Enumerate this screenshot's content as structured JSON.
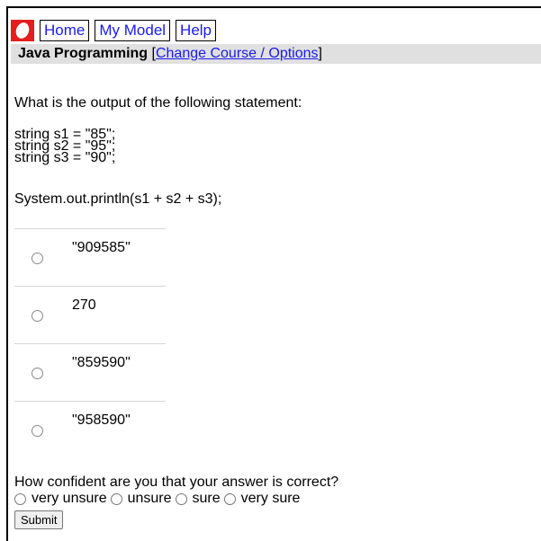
{
  "nav": {
    "home_label": "Home",
    "model_label": "My Model",
    "help_label": "Help"
  },
  "course": {
    "name": "Java Programming",
    "open_bracket": "[",
    "link_label": "Change Course / Options",
    "close_bracket": "]"
  },
  "question": {
    "prompt": "What is the output of the following statement:",
    "code_lines": [
      "string s1 = \"85\";",
      "string s2 = \"95\";",
      "string s3 = \"90\";"
    ],
    "print_line": "System.out.println(s1 + s2 + s3);",
    "choices": [
      "\"909585\"",
      "270",
      "\"859590\"",
      "\"958590\""
    ]
  },
  "confidence": {
    "prompt": "How confident are you that your answer is correct?",
    "options": [
      "very unsure",
      "unsure",
      "sure",
      "very sure"
    ]
  },
  "submit_label": "Submit",
  "colors": {
    "logo": "#e41e1e",
    "link": "#1a1aee",
    "course_bar": "#e0e0e0"
  }
}
